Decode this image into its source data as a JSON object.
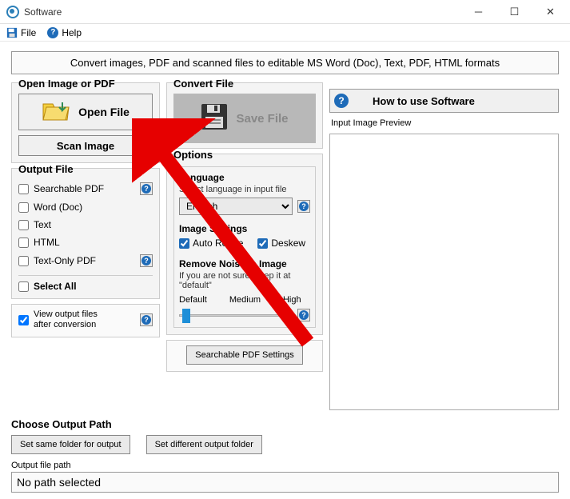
{
  "window": {
    "title": "Software"
  },
  "menu": {
    "file": "File",
    "help": "Help"
  },
  "banner": "Convert images, PDF and scanned files to editable MS Word (Doc), Text, PDF, HTML formats",
  "open": {
    "title": "Open Image or PDF",
    "openfile": "Open File",
    "scan": "Scan Image"
  },
  "convert": {
    "title": "Convert File",
    "savefile": "Save File"
  },
  "output": {
    "title": "Output File",
    "searchable_pdf": "Searchable PDF",
    "word": "Word (Doc)",
    "text": "Text",
    "html": "HTML",
    "textonly_pdf": "Text-Only PDF",
    "select_all": "Select All"
  },
  "options": {
    "title": "Options",
    "lang_title": "Language",
    "lang_desc": "Select language in input file",
    "lang_value": "English",
    "img_title": "Image Settings",
    "autorotate": "Auto Rotate",
    "deskew": "Deskew",
    "noise_title": "Remove Noise in Image",
    "noise_desc": "If you are not sure, keep it at \"default\"",
    "noise_default": "Default",
    "noise_medium": "Medium",
    "noise_high": "High",
    "searchable_btn": "Searchable PDF Settings"
  },
  "view_output": "View output files after conversion",
  "outpath": {
    "title": "Choose Output Path",
    "same": "Set same folder for output",
    "diff": "Set different output folder"
  },
  "howto": "How to use Software",
  "preview_label": "Input Image Preview",
  "outfile": {
    "label": "Output file path",
    "value": "No path selected"
  }
}
